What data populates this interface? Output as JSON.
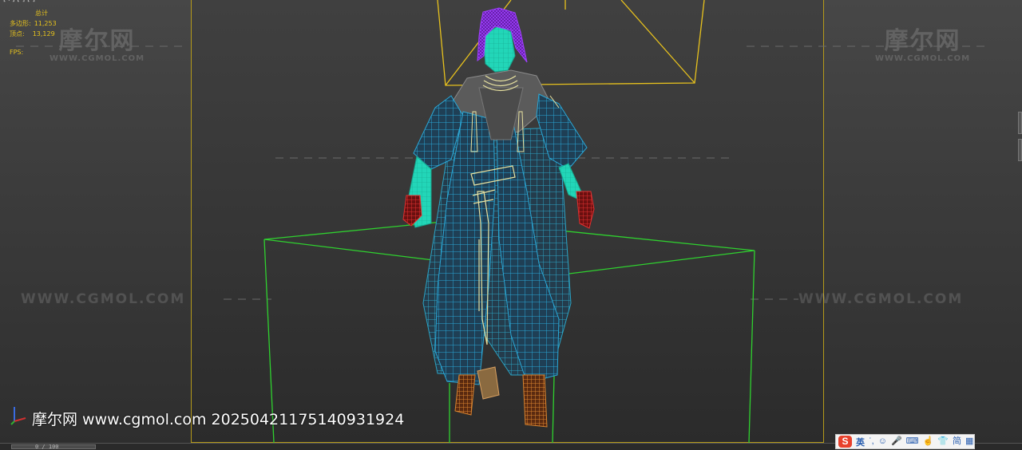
{
  "viewport": {
    "corner_label": "[+] [ ] [ ]"
  },
  "stats": {
    "total_label": "总计",
    "polys_label": "多边形:",
    "polys_value": "11,253",
    "verts_label": "顶点:",
    "verts_value": "13,129",
    "fps_label": "FPS:"
  },
  "watermarks": {
    "logo_cn": "摩尔网",
    "logo_en": "WWW.CGMOL.COM",
    "url": "WWW.CGMOL.COM"
  },
  "stamp": {
    "text": "摩尔网 www.cgmol.com 20250421175140931924"
  },
  "timeline": {
    "frame_text": "0 / 100"
  },
  "ime": {
    "logo": "S",
    "lang": "英",
    "icons": [
      "punctuation-icon",
      "emoji-icon",
      "mic-icon",
      "keyboard-icon",
      "hand-icon",
      "skin-icon",
      "traditional-icon",
      "grid-icon"
    ],
    "glyphs": [
      "ʾ,",
      "☺",
      "🎤",
      "⌨",
      "☝",
      "👕",
      "简",
      "▦"
    ]
  },
  "colors": {
    "frame": "#b59a1a",
    "stats_text": "#e6c21d",
    "cloth_wire": "#2aa7d6",
    "skin": "#22d6b8",
    "hair": "#8a2ad6",
    "gloves": "#d42a2a",
    "boots": "#d27a2a",
    "gold_wire": "#e8e2a0",
    "bbox": "#2fd12f",
    "camera": "#e8c21d"
  }
}
